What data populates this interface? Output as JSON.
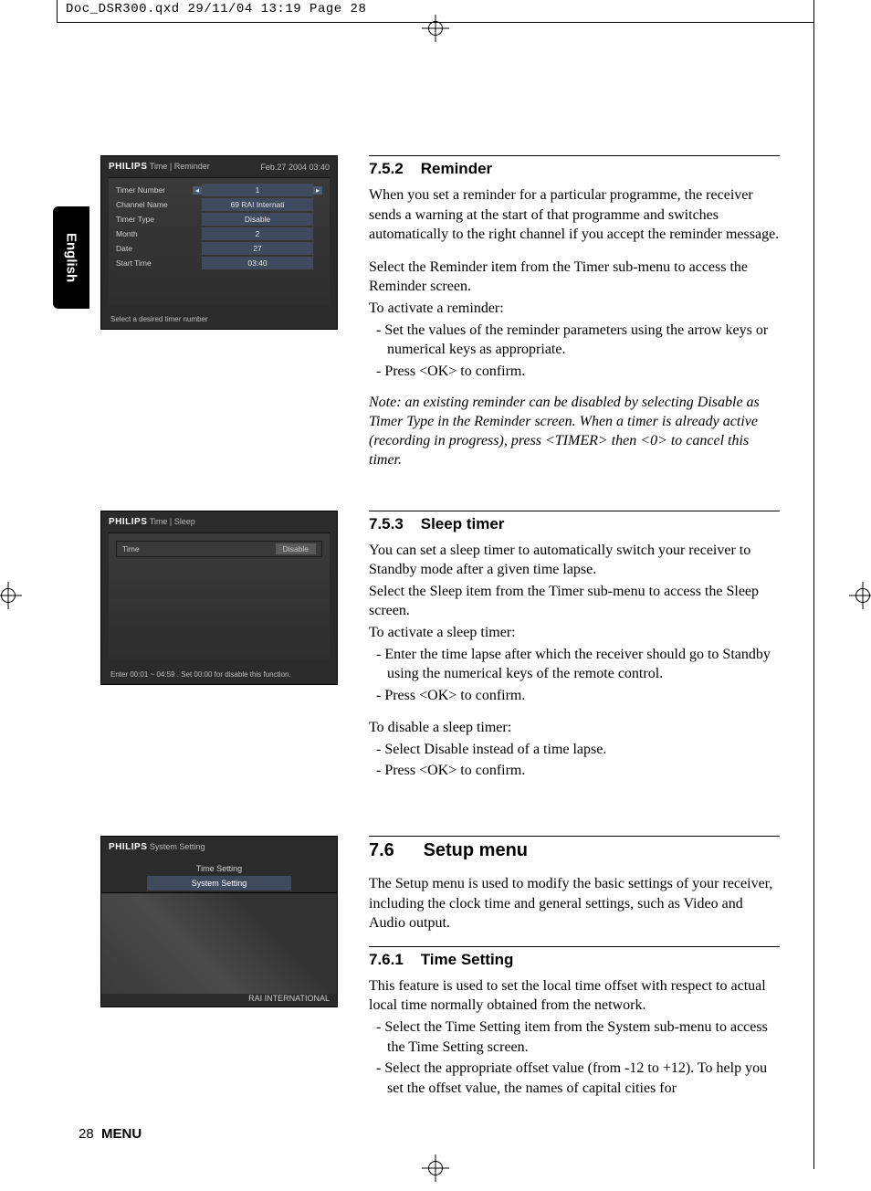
{
  "print_header": "Doc_DSR300.qxd   29/11/04  13:19  Page 28",
  "lang_tab": "English",
  "page_footer": {
    "number": "28",
    "section": "MENU"
  },
  "section_752": {
    "num": "7.5.2",
    "title": "Reminder",
    "para1": "When you set a reminder for a particular programme, the receiver sends a warning at the start of that programme and switches automatically to the right channel if you accept the reminder message.",
    "para2": "Select the Reminder item from the Timer sub-menu to access the Reminder screen.",
    "para3": "To activate a reminder:",
    "list": [
      "Set the values of the reminder parameters using the arrow keys or numerical keys as appropriate.",
      "Press <OK> to confirm."
    ],
    "note": "Note: an existing reminder can be disabled by selecting Disable as Timer Type in the Reminder screen. When a timer is already active (recording in progress), press <TIMER> then <0> to cancel this timer."
  },
  "section_753": {
    "num": "7.5.3",
    "title": "Sleep timer",
    "para1": "You can set a sleep timer to automatically switch your receiver to Standby mode after a given time lapse.",
    "para2": "Select the Sleep item from the Timer sub-menu to access the Sleep screen.",
    "para3": "To activate a sleep timer:",
    "list1": [
      "Enter the time lapse after which the receiver should go to Standby using the numerical keys of the remote control.",
      "Press <OK> to confirm."
    ],
    "para4": "To disable a sleep timer:",
    "list2": [
      "Select Disable instead of a time lapse.",
      "Press <OK> to confirm."
    ]
  },
  "section_76": {
    "num": "7.6",
    "title": "Setup menu",
    "para": "The Setup menu is used to modify the basic settings of your receiver, including the clock time and general settings, such as Video and Audio output."
  },
  "section_761": {
    "num": "7.6.1",
    "title": "Time Setting",
    "para1": "This feature is used to set the local time offset with respect to actual local time normally obtained from the network.",
    "list": [
      "Select the Time Setting item from the System sub-menu to access the Time Setting screen.",
      "Select the appropriate offset value (from -12 to +12). To help you set the offset value, the names of capital cities for"
    ]
  },
  "ss_reminder": {
    "brand": "PHILIPS",
    "breadcrumb": "Time | Reminder",
    "datetime": "Feb.27 2004  03:40",
    "rows": {
      "timer_number_label": "Timer Number",
      "timer_number": "1",
      "channel_name_label": "Channel Name",
      "channel_name": "69 RAI Internati",
      "timer_type_label": "Timer Type",
      "timer_type": "Disable",
      "month_label": "Month",
      "month": "2",
      "date_label": "Date",
      "date": "27",
      "start_time_label": "Start Time",
      "start_time": "03:40"
    },
    "hint": "Select a desired timer number"
  },
  "ss_sleep": {
    "brand": "PHILIPS",
    "breadcrumb": "Time | Sleep",
    "time_label": "Time",
    "time_value": "Disable",
    "hint": "Enter 00:01 ~ 04:59 . Set 00:00 for disable this function."
  },
  "ss_setup": {
    "brand": "PHILIPS",
    "breadcrumb": "System Setting",
    "items": [
      "Time Setting",
      "System Setting"
    ],
    "logo": "RAI INTERNATIONAL"
  }
}
